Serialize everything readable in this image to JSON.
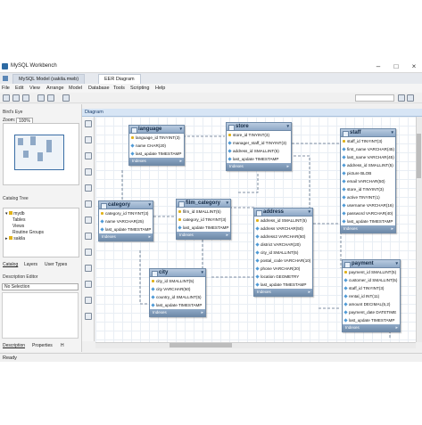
{
  "window": {
    "title": "MySQL Workbench"
  },
  "tabs": [
    {
      "label": "MySQL Model (sakila.mwb)"
    },
    {
      "label": "EER Diagram"
    }
  ],
  "menu": [
    "File",
    "Edit",
    "View",
    "Arrange",
    "Model",
    "Database",
    "Tools",
    "Scripting",
    "Help"
  ],
  "left_panel": {
    "birdseye_title": "Bird's Eye",
    "zoom_label": "Zoom:",
    "zoom_value": "100%",
    "catalog_title": "Catalog Tree",
    "tree": {
      "schema": "mydb",
      "children": [
        "Tables",
        "Views",
        "Routine Groups"
      ],
      "schema2": "sakila"
    },
    "panel_tabs": [
      "Catalog",
      "Layers",
      "User Types"
    ],
    "description_title": "Description Editor",
    "description_select": "No Selection",
    "bottom_tabs": [
      "Description",
      "Properties",
      "H"
    ]
  },
  "diagram_title": "Diagram",
  "tables": {
    "language": {
      "name": "language",
      "columns": [
        "language_id TINYINT(3)",
        "name CHAR(20)",
        "last_update TIMESTAMP"
      ],
      "footer": "Indexes"
    },
    "store": {
      "name": "store",
      "columns": [
        "store_id TINYINT(3)",
        "manager_staff_id TINYINT(3)",
        "address_id SMALLINT(5)",
        "last_update TIMESTAMP"
      ],
      "footer": "Indexes"
    },
    "staff": {
      "name": "staff",
      "columns": [
        "staff_id TINYINT(3)",
        "first_name VARCHAR(45)",
        "last_name VARCHAR(45)",
        "address_id SMALLINT(5)",
        "picture BLOB",
        "email VARCHAR(50)",
        "store_id TINYINT(3)",
        "active TINYINT(1)",
        "username VARCHAR(16)",
        "password VARCHAR(40)",
        "last_update TIMESTAMP"
      ],
      "footer": "Indexes"
    },
    "category": {
      "name": "category",
      "columns": [
        "category_id TINYINT(3)",
        "name VARCHAR(25)",
        "last_update TIMESTAMP"
      ],
      "footer": "Indexes"
    },
    "film_category": {
      "name": "film_category",
      "columns": [
        "film_id SMALLINT(5)",
        "category_id TINYINT(3)",
        "last_update TIMESTAMP"
      ],
      "footer": "Indexes"
    },
    "address": {
      "name": "address",
      "columns": [
        "address_id SMALLINT(5)",
        "address VARCHAR(50)",
        "address2 VARCHAR(50)",
        "district VARCHAR(20)",
        "city_id SMALLINT(5)",
        "postal_code VARCHAR(10)",
        "phone VARCHAR(20)",
        "location GEOMETRY",
        "last_update TIMESTAMP"
      ],
      "footer": "Indexes"
    },
    "city": {
      "name": "city",
      "columns": [
        "city_id SMALLINT(5)",
        "city VARCHAR(50)",
        "country_id SMALLINT(5)",
        "last_update TIMESTAMP"
      ],
      "footer": "Indexes"
    },
    "payment": {
      "name": "payment",
      "columns": [
        "payment_id SMALLINT(5)",
        "customer_id SMALLINT(5)",
        "staff_id TINYINT(3)",
        "rental_id INT(11)",
        "amount DECIMAL(5,2)",
        "payment_date DATETIME",
        "last_update TIMESTAMP"
      ],
      "footer": "Indexes"
    }
  },
  "status": "Ready",
  "colors": {
    "accent": "#d7e5f5",
    "table_header": "#8fa9c7",
    "pk_key": "#e0b21a"
  }
}
